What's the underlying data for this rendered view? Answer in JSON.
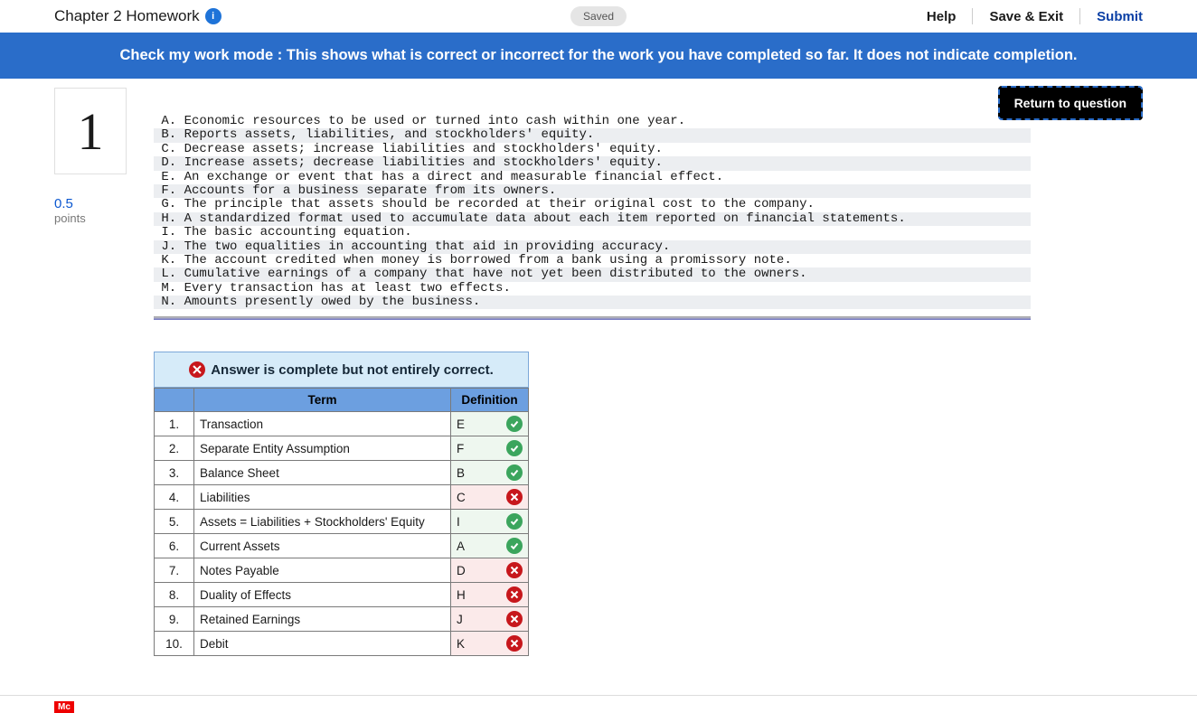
{
  "header": {
    "title": "Chapter 2 Homework",
    "info_glyph": "i",
    "saved": "Saved",
    "help": "Help",
    "save_exit": "Save & Exit",
    "submit": "Submit"
  },
  "banner": "Check my work mode : This shows what is correct or incorrect for the work you have completed so far. It does not indicate completion.",
  "return_btn": "Return to question",
  "question": {
    "number": "1",
    "points": "0.5",
    "points_label": "points"
  },
  "definitions": [
    {
      "letter": "A",
      "text": "Economic resources to be used or turned into cash within one year."
    },
    {
      "letter": "B",
      "text": "Reports assets, liabilities, and stockholders' equity."
    },
    {
      "letter": "C",
      "text": "Decrease assets; increase liabilities and stockholders' equity."
    },
    {
      "letter": "D",
      "text": "Increase assets; decrease liabilities and stockholders' equity."
    },
    {
      "letter": "E",
      "text": "An exchange or event that has a direct and measurable financial effect."
    },
    {
      "letter": "F",
      "text": "Accounts for a business separate from its owners."
    },
    {
      "letter": "G",
      "text": "The principle that assets should be recorded at their original cost to the company."
    },
    {
      "letter": "H",
      "text": "A standardized format used to accumulate data about each item reported on financial statements."
    },
    {
      "letter": "I",
      "text": "The basic accounting equation."
    },
    {
      "letter": "J",
      "text": "The two equalities in accounting that aid in providing accuracy."
    },
    {
      "letter": "K",
      "text": "The account credited when money is borrowed from a bank using a promissory note."
    },
    {
      "letter": "L",
      "text": "Cumulative earnings of a company that have not yet been distributed to the owners."
    },
    {
      "letter": "M",
      "text": "Every transaction has at least two effects."
    },
    {
      "letter": "N",
      "text": "Amounts presently owed by the business."
    }
  ],
  "answer_status": {
    "icon": "cross",
    "text": "Answer is complete but not entirely correct."
  },
  "table": {
    "col_term": "Term",
    "col_def": "Definition",
    "rows": [
      {
        "n": "1.",
        "term": "Transaction",
        "def": "E",
        "correct": true
      },
      {
        "n": "2.",
        "term": "Separate Entity Assumption",
        "def": "F",
        "correct": true
      },
      {
        "n": "3.",
        "term": "Balance Sheet",
        "def": "B",
        "correct": true
      },
      {
        "n": "4.",
        "term": "Liabilities",
        "def": "C",
        "correct": false
      },
      {
        "n": "5.",
        "term": "Assets = Liabilities + Stockholders' Equity",
        "def": "I",
        "correct": true
      },
      {
        "n": "6.",
        "term": "Current Assets",
        "def": "A",
        "correct": true
      },
      {
        "n": "7.",
        "term": "Notes Payable",
        "def": "D",
        "correct": false
      },
      {
        "n": "8.",
        "term": "Duality of Effects",
        "def": "H",
        "correct": false
      },
      {
        "n": "9.",
        "term": "Retained Earnings",
        "def": "J",
        "correct": false
      },
      {
        "n": "10.",
        "term": "Debit",
        "def": "K",
        "correct": false
      }
    ]
  },
  "footer_logo": "Mc"
}
